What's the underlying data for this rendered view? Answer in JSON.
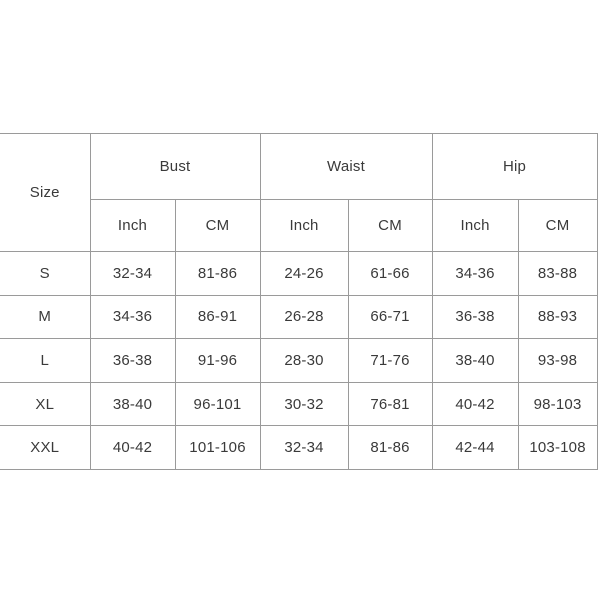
{
  "chart_data": {
    "type": "table",
    "title": "",
    "size_header": "Size",
    "group_headers": [
      "Bust",
      "Waist",
      "Hip"
    ],
    "unit_headers": [
      "Inch",
      "CM"
    ],
    "columns": [
      "Size",
      "Bust Inch",
      "Bust CM",
      "Waist Inch",
      "Waist CM",
      "Hip Inch",
      "Hip CM"
    ],
    "rows": [
      {
        "size": "S",
        "bust_inch": "32-34",
        "bust_cm": "81-86",
        "waist_inch": "24-26",
        "waist_cm": "61-66",
        "hip_inch": "34-36",
        "hip_cm": "83-88"
      },
      {
        "size": "M",
        "bust_inch": "34-36",
        "bust_cm": "86-91",
        "waist_inch": "26-28",
        "waist_cm": "66-71",
        "hip_inch": "36-38",
        "hip_cm": "88-93"
      },
      {
        "size": "L",
        "bust_inch": "36-38",
        "bust_cm": "91-96",
        "waist_inch": "28-30",
        "waist_cm": "71-76",
        "hip_inch": "38-40",
        "hip_cm": "93-98"
      },
      {
        "size": "XL",
        "bust_inch": "38-40",
        "bust_cm": "96-101",
        "waist_inch": "30-32",
        "waist_cm": "76-81",
        "hip_inch": "40-42",
        "hip_cm": "98-103"
      },
      {
        "size": "XXL",
        "bust_inch": "40-42",
        "bust_cm": "101-106",
        "waist_inch": "32-34",
        "waist_cm": "81-86",
        "hip_inch": "42-44",
        "hip_cm": "103-108"
      }
    ]
  },
  "colors": {
    "background": "#ffffff",
    "grid_line": "#9a9a9a",
    "text": "#3a3a3a"
  }
}
